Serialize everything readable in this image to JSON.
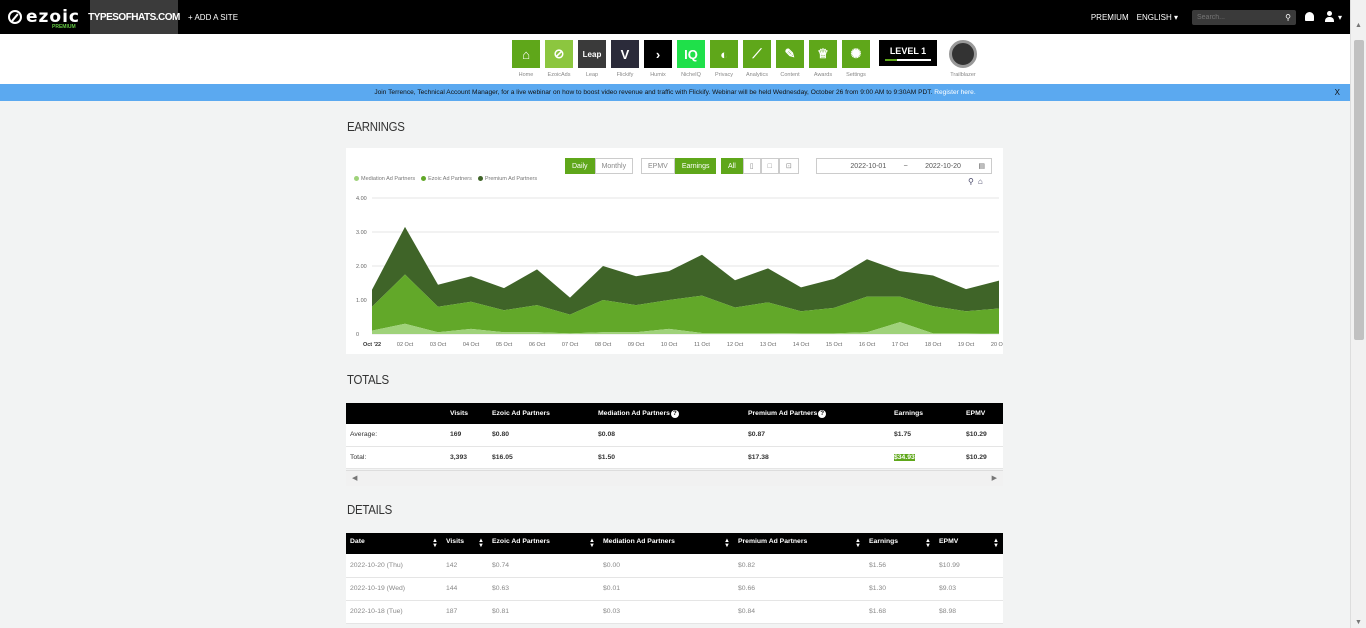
{
  "topbar": {
    "logo": "ezoic",
    "logo_sub": "PREMIUM",
    "site": "TYPESOFHATS.COM",
    "add_site": "+ ADD A SITE",
    "premium": "PREMIUM",
    "language": "ENGLISH ▾",
    "search_placeholder": "Search..."
  },
  "apps": [
    {
      "label": "Home",
      "glyph": "⌂",
      "color": "#5fa71a"
    },
    {
      "label": "EzoicAds",
      "glyph": "⊘",
      "color": "#8cc63f"
    },
    {
      "label": "Leap",
      "glyph": "Leap",
      "color": "#3a3a3a"
    },
    {
      "label": "Flickify",
      "glyph": "V",
      "color": "#2b2b3a"
    },
    {
      "label": "Humix",
      "glyph": "›",
      "color": "#000000"
    },
    {
      "label": "NicheIQ",
      "glyph": "IQ",
      "color": "#1fe04a"
    },
    {
      "label": "Privacy",
      "glyph": "◐",
      "color": "#5fa71a"
    },
    {
      "label": "Analytics",
      "glyph": "⟋",
      "color": "#5fa71a"
    },
    {
      "label": "Content",
      "glyph": "✎",
      "color": "#5fa71a"
    },
    {
      "label": "Awards",
      "glyph": "♕",
      "color": "#5fa71a"
    },
    {
      "label": "Settings",
      "glyph": "✺",
      "color": "#5fa71a"
    }
  ],
  "level": "LEVEL 1",
  "trailblazer": "Trailblazer",
  "banner": {
    "text": "Join Terrence, Technical Account Manager, for a live webinar on how to boost video revenue and traffic with Flickify. Webinar will be held Wednesday, October 26 from 9:00 AM to 9:30AM PDT.",
    "link": "Register here.",
    "close": "X"
  },
  "earnings": {
    "title": "EARNINGS",
    "period_buttons": [
      "Daily",
      "Monthly"
    ],
    "metric_buttons": [
      "EPMV",
      "Earnings"
    ],
    "device_all": "All",
    "date_from": "2022-10-01",
    "date_sep": "~",
    "date_to": "2022-10-20"
  },
  "chart_data": {
    "type": "area",
    "stacked": true,
    "x": [
      "Oct '22",
      "02 Oct",
      "03 Oct",
      "04 Oct",
      "05 Oct",
      "06 Oct",
      "07 Oct",
      "08 Oct",
      "09 Oct",
      "10 Oct",
      "11 Oct",
      "12 Oct",
      "13 Oct",
      "14 Oct",
      "15 Oct",
      "16 Oct",
      "17 Oct",
      "18 Oct",
      "19 Oct",
      "20 Oct"
    ],
    "yticks": [
      "0",
      "1.00",
      "2.00",
      "3.00",
      "4.00"
    ],
    "ylim": [
      0,
      4
    ],
    "grid": true,
    "legend_position": "top-left",
    "series": [
      {
        "name": "Mediation Ad Partners",
        "color": "#9fd27a",
        "values": [
          0.1,
          0.3,
          0.05,
          0.15,
          0.05,
          0.05,
          0.02,
          0.05,
          0.05,
          0.15,
          0.03,
          0.03,
          0.03,
          0.02,
          0.02,
          0.05,
          0.35,
          0.02,
          0.02,
          0.01
        ]
      },
      {
        "name": "Ezoic Ad Partners",
        "color": "#62a829",
        "values": [
          0.7,
          1.45,
          0.75,
          0.8,
          0.65,
          0.8,
          0.55,
          0.95,
          0.8,
          0.85,
          1.1,
          0.75,
          0.9,
          0.65,
          0.75,
          1.05,
          0.75,
          0.8,
          0.65,
          0.74
        ]
      },
      {
        "name": "Premium Ad Partners",
        "color": "#3f6428",
        "values": [
          0.5,
          1.4,
          0.65,
          0.75,
          0.65,
          1.05,
          0.5,
          1.0,
          0.85,
          0.85,
          1.2,
          0.8,
          1.0,
          0.7,
          0.85,
          1.1,
          0.75,
          0.9,
          0.65,
          0.82
        ]
      }
    ]
  },
  "totals": {
    "title": "TOTALS",
    "headers": [
      "",
      "Visits",
      "Ezoic Ad Partners",
      "Mediation Ad Partners",
      "Premium Ad Partners",
      "Earnings",
      "EPMV"
    ],
    "rows": [
      [
        "Average:",
        "169",
        "$0.80",
        "$0.08",
        "$0.87",
        "$1.75",
        "$10.29"
      ],
      [
        "Total:",
        "3,393",
        "$16.05",
        "$1.50",
        "$17.38",
        "$34.93",
        "$10.29"
      ]
    ]
  },
  "details": {
    "title": "DETAILS",
    "headers": [
      "Date",
      "Visits",
      "Ezoic Ad Partners",
      "Mediation Ad Partners",
      "Premium Ad Partners",
      "Earnings",
      "EPMV"
    ],
    "rows": [
      [
        "2022-10-20 (Thu)",
        "142",
        "$0.74",
        "$0.00",
        "$0.82",
        "$1.56",
        "$10.99"
      ],
      [
        "2022-10-19 (Wed)",
        "144",
        "$0.63",
        "$0.01",
        "$0.66",
        "$1.30",
        "$9.03"
      ],
      [
        "2022-10-18 (Tue)",
        "187",
        "$0.81",
        "$0.03",
        "$0.84",
        "$1.68",
        "$8.98"
      ]
    ]
  }
}
